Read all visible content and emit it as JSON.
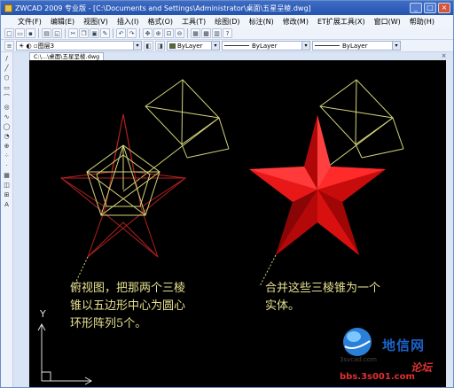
{
  "window": {
    "title": "ZWCAD 2009 专业版 - [C:\\Documents and Settings\\Administrator\\桌面\\五星呈棱.dwg]",
    "min": "_",
    "max": "□",
    "close": "×"
  },
  "menu": [
    "文件(F)",
    "编辑(E)",
    "视图(V)",
    "插入(I)",
    "格式(O)",
    "工具(T)",
    "绘图(D)",
    "标注(N)",
    "修改(M)",
    "ET扩展工具(X)",
    "窗口(W)",
    "帮助(H)"
  ],
  "toolbar": {
    "layer": "图层3",
    "color": "ByLayer",
    "color_swatch": "#556b2f",
    "linetype": "ByLayer",
    "lineweight": "ByLayer"
  },
  "left_tools": [
    "/",
    "╱",
    "⬡",
    "▭",
    "⌒",
    "◎",
    "∿",
    "◯",
    "◔",
    "⊕",
    "⁘",
    "·",
    "▦",
    "◫",
    "⊞",
    "A"
  ],
  "doc_tab": "C:\\...\\桌面\\五星呈棱.dwg",
  "doc_close": "×",
  "captions": {
    "left": [
      "俯视图，把那两个三棱",
      "锥以五边形中心为圆心",
      "环形阵列5个。"
    ],
    "right": [
      "合并这些三棱锥为一个",
      "实体。"
    ]
  },
  "ucs": {
    "y": "Y"
  },
  "watermark": {
    "site": "地信网",
    "sub": "3svcad.com",
    "forum": "论坛",
    "url": "bbs.3s001.com"
  },
  "colors": {
    "outline": "#d4d47a",
    "star_red": "#ff1a1a",
    "wire_red": "#b02020"
  }
}
